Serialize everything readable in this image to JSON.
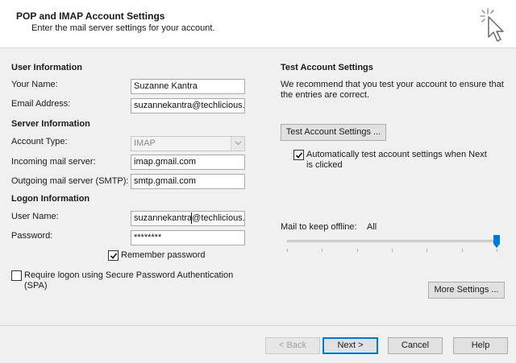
{
  "header": {
    "title": "POP and IMAP Account Settings",
    "subtitle": "Enter the mail server settings for your account."
  },
  "user_info": {
    "section": "User Information",
    "name_label": "Your Name:",
    "name_value": "Suzanne Kantra",
    "email_label": "Email Address:",
    "email_value": "suzannekantra@techlicious."
  },
  "server_info": {
    "section": "Server Information",
    "account_type_label": "Account Type:",
    "account_type_value": "IMAP",
    "incoming_label": "Incoming mail server:",
    "incoming_value": "imap.gmail.com",
    "outgoing_label": "Outgoing mail server (SMTP):",
    "outgoing_value": "smtp.gmail.com"
  },
  "logon_info": {
    "section": "Logon Information",
    "username_label": "User Name:",
    "username_value": "suzannekantra@techlicious.",
    "password_label": "Password:",
    "password_value": "********",
    "remember_label": "Remember password",
    "remember_checked": true,
    "spa_label_line1": "Require logon using Secure Password Authentication",
    "spa_label_line2": "(SPA)",
    "spa_checked": false
  },
  "test_settings": {
    "section": "Test Account Settings",
    "desc_line1": "We recommend that you test your account to ensure that",
    "desc_line2": "the entries are correct.",
    "test_button": "Test Account Settings ...",
    "auto_label_line1": "Automatically test account settings when Next",
    "auto_label_line2": "is clicked",
    "auto_checked": true
  },
  "offline": {
    "label": "Mail to keep offline:",
    "value": "All",
    "slider_level": 1.0
  },
  "more_settings_button": "More Settings ...",
  "footer": {
    "back": "< Back",
    "next": "Next >",
    "cancel": "Cancel",
    "help": "Help"
  },
  "colors": {
    "accent": "#0078d7",
    "slider_thumb": "#0078d7"
  }
}
